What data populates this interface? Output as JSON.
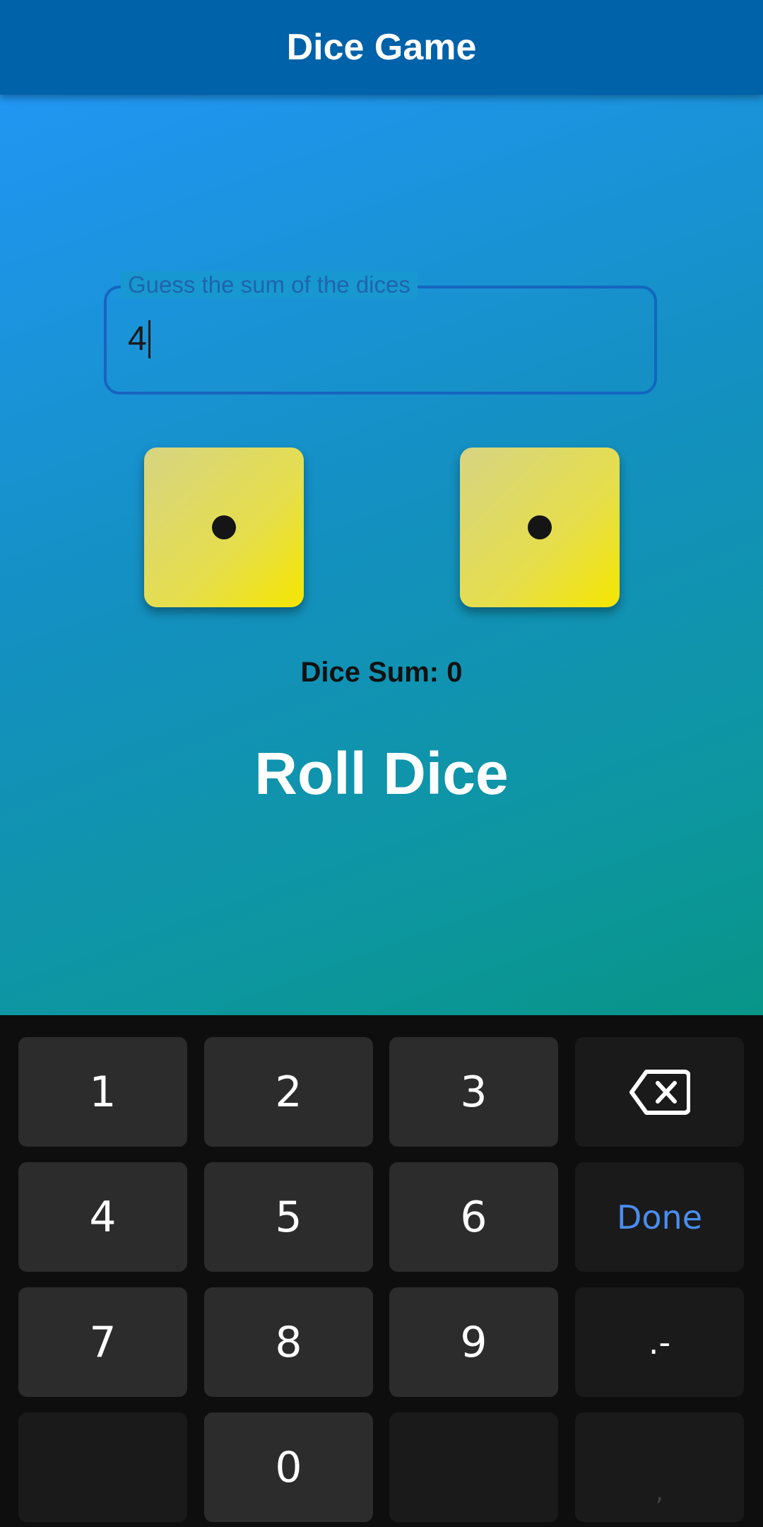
{
  "app_bar": {
    "title": "Dice Game"
  },
  "guess_field": {
    "label": "Guess the sum of the dices",
    "value": "4"
  },
  "dice": [
    {
      "face": 1
    },
    {
      "face": 1
    }
  ],
  "sum_text": "Dice Sum: 0",
  "roll_button": {
    "label": "Roll Dice"
  },
  "keyboard": {
    "row1": [
      "1",
      "2",
      "3"
    ],
    "row2": [
      "4",
      "5",
      "6"
    ],
    "done_label": "Done",
    "row3": [
      "7",
      "8",
      "9"
    ],
    "symbol_label": ".-",
    "zero": "0",
    "comma": ","
  },
  "colors": {
    "app_bar": "#0062A8",
    "gradient_start": "#2196F3",
    "gradient_end": "#089588",
    "die_face": "#E6DE4B",
    "done_accent": "#4A8DF0"
  }
}
